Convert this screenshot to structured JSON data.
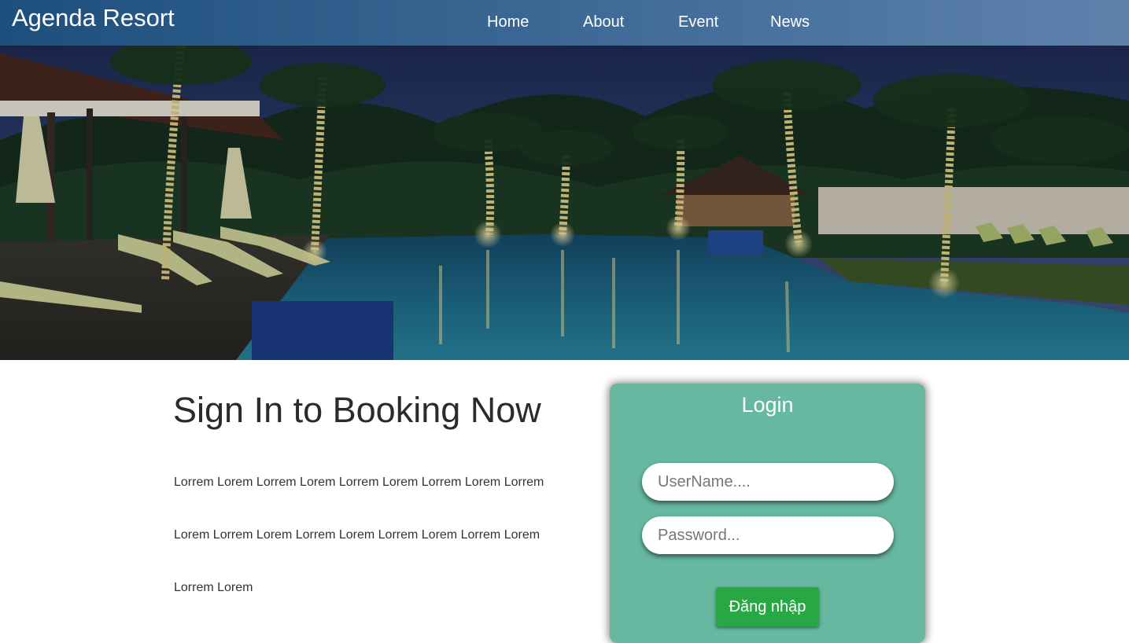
{
  "header": {
    "brand": "Agenda Resort",
    "nav": [
      {
        "label": "Home"
      },
      {
        "label": "About"
      },
      {
        "label": "Event"
      },
      {
        "label": "News"
      }
    ]
  },
  "main": {
    "heading": "Sign In to Booking Now",
    "paragraphs": [
      "Lorrem Lorem Lorrem Lorem Lorrem Lorem Lorrem Lorem Lorrem",
      "Lorem Lorrem Lorem Lorrem Lorem Lorrem Lorem Lorrem Lorem",
      "Lorrem Lorem"
    ]
  },
  "login": {
    "title": "Login",
    "username_placeholder": "UserName....",
    "password_placeholder": "Password...",
    "submit_label": "Đăng nhập"
  },
  "colors": {
    "header_start": "#1d4f7d",
    "header_end": "#5f82ad",
    "login_card": "#67b8a0",
    "submit_button": "#28a745"
  }
}
